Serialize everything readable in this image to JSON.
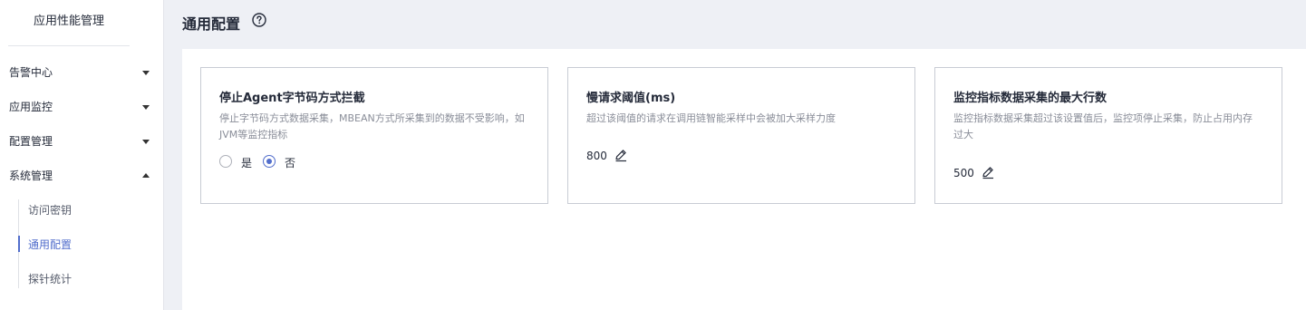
{
  "sidebar": {
    "app_title": "应用性能管理",
    "items": [
      {
        "label": "告警中心",
        "expanded": false
      },
      {
        "label": "应用监控",
        "expanded": false
      },
      {
        "label": "配置管理",
        "expanded": false
      },
      {
        "label": "系统管理",
        "expanded": true
      }
    ],
    "sub_items": [
      {
        "label": "访问密钥",
        "active": false
      },
      {
        "label": "通用配置",
        "active": true
      },
      {
        "label": "探针统计",
        "active": false
      }
    ]
  },
  "header": {
    "title": "通用配置",
    "help_icon": "question-circle-icon"
  },
  "cards": [
    {
      "title": "停止Agent字节码方式拦截",
      "desc": "停止字节码方式数据采集，MBEAN方式所采集到的数据不受影响，如JVM等监控指标",
      "options": [
        {
          "label": "是",
          "checked": false
        },
        {
          "label": "否",
          "checked": true
        }
      ]
    },
    {
      "title": "慢请求阈值(ms)",
      "desc": "超过该阈值的请求在调用链智能采样中会被加大采样力度",
      "value": "800",
      "edit_icon": "pencil-icon"
    },
    {
      "title": "监控指标数据采集的最大行数",
      "desc": "监控指标数据采集超过该设置值后，监控项停止采集，防止占用内存过大",
      "value": "500",
      "edit_icon": "pencil-icon"
    }
  ],
  "colors": {
    "accent": "#526ecc",
    "background": "#eef0f5",
    "border": "#c8ccd4"
  }
}
